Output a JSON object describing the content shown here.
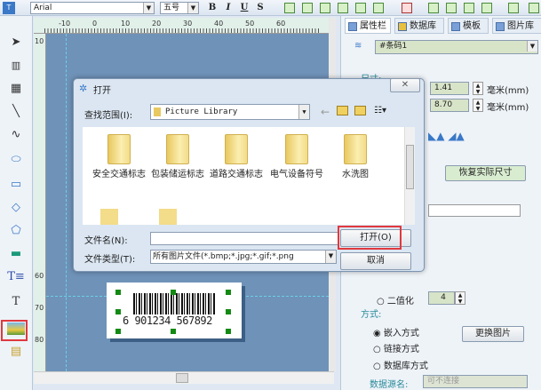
{
  "toolbar": {
    "font": "Arial",
    "size": "五号",
    "bold": "B",
    "italic": "I",
    "underline": "U",
    "strike": "S"
  },
  "ruler": {
    "h_ticks": [
      "-10",
      "0",
      "10",
      "20",
      "30",
      "40",
      "50",
      "60"
    ],
    "v_ticks": [
      "10",
      "60",
      "70",
      "80"
    ]
  },
  "left_tools": [
    "pointer",
    "barcode",
    "qrcode",
    "line",
    "curve",
    "ellipse",
    "rectangle",
    "diamond",
    "polygon",
    "fill-rect",
    "text-box",
    "text",
    "image",
    "table"
  ],
  "tabs": [
    "属性栏",
    "数据库",
    "模板",
    "图片库"
  ],
  "props": {
    "object": "#条码1",
    "size_label": "尺寸:",
    "width": "1.41",
    "height": "8.70",
    "unit": "毫米(mm)",
    "restore_button": "恢复实际尺寸",
    "binarize_label": "二值化",
    "binarize_value": "4",
    "mode_label": "方式:",
    "modes": [
      "嵌入方式",
      "链接方式",
      "数据库方式"
    ],
    "selected_mode": "嵌入方式",
    "replace_button": "更换图片",
    "datasource_label": "数据源名:",
    "datasource_value": "可不连接"
  },
  "dialog": {
    "title": "打开",
    "look_in_label": "查找范围(I):",
    "look_in": "Picture Library",
    "folders": [
      "安全交通标志",
      "包装储运标志",
      "道路交通标志",
      "电气设备符号",
      "水洗图"
    ],
    "filename_label": "文件名(N):",
    "filename": "",
    "filetype_label": "文件类型(T):",
    "filetype": "所有图片文件(*.bmp;*.jpg;*.gif;*.png",
    "open_button": "打开(O)",
    "cancel_button": "取消",
    "close": "✕"
  },
  "barcode": {
    "text": "6 901234 567892"
  },
  "colors": {
    "highlight": "#e0393e",
    "canvas": "#6f92b8"
  }
}
